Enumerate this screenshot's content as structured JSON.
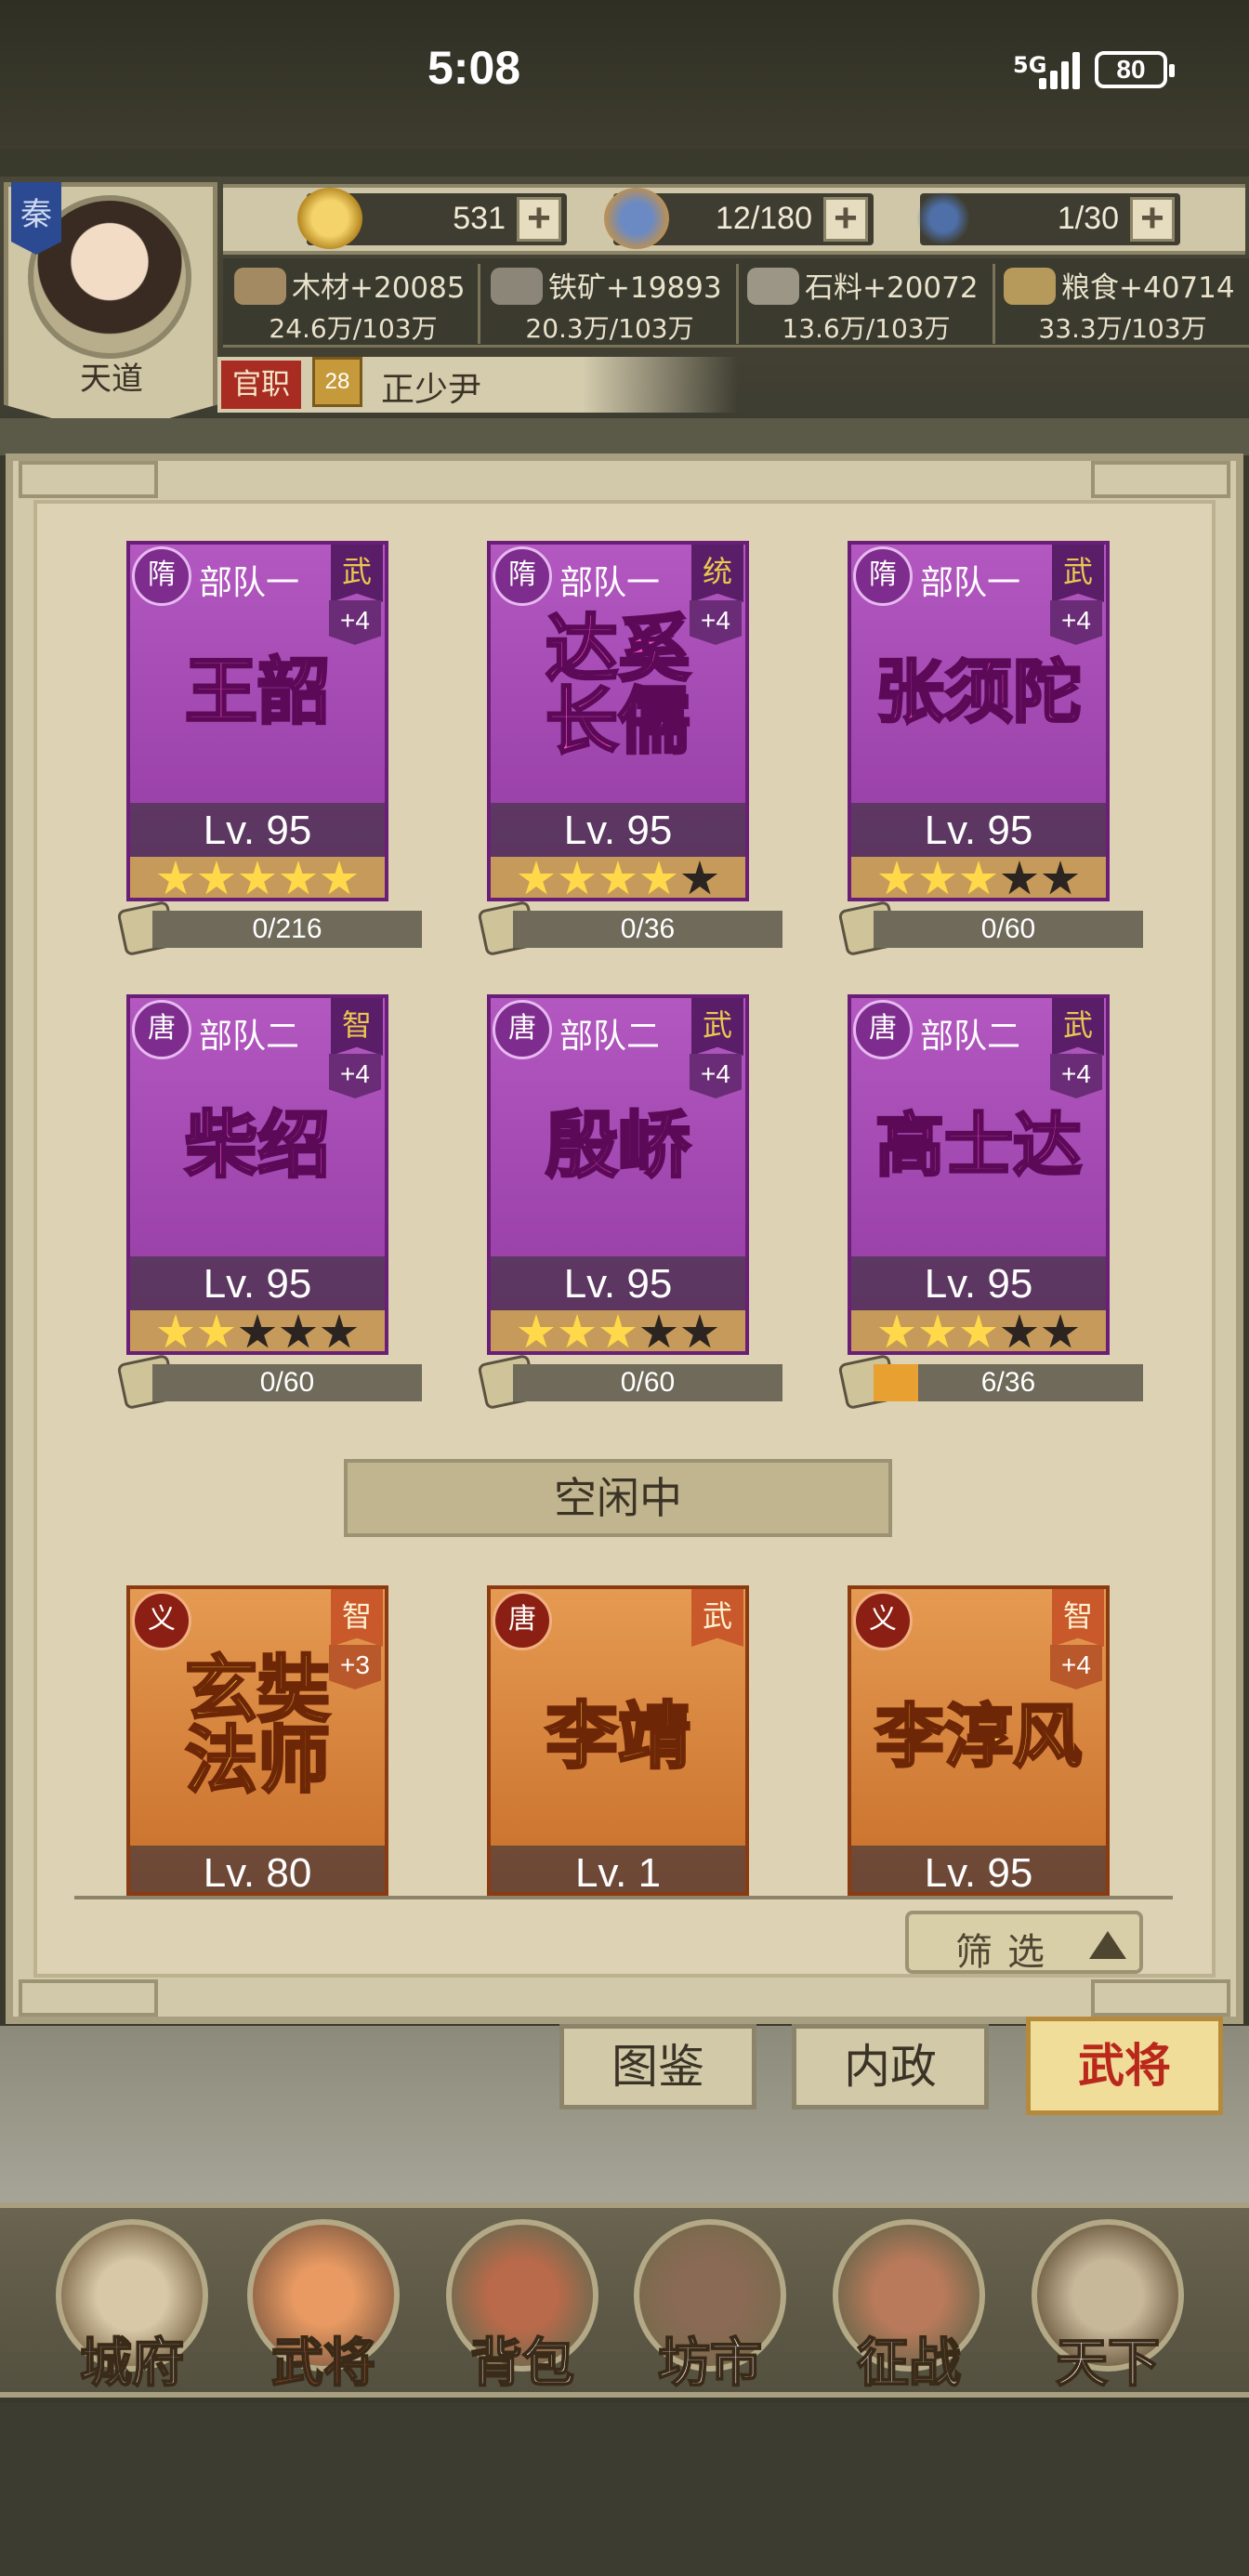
{
  "status_bar": {
    "time": "5:08",
    "signal": "5G",
    "battery": "80"
  },
  "player": {
    "faction": "秦",
    "name": "天道",
    "rank_label": "官职",
    "rank_level": "28",
    "rank_title": "正少尹"
  },
  "resources": {
    "gold": "531",
    "food_supply": "12/180",
    "tokens": "1/30",
    "wood": {
      "label": "木材+20085",
      "amount": "24.6万/103万"
    },
    "iron": {
      "label": "铁矿+19893",
      "amount": "20.3万/103万"
    },
    "stone": {
      "label": "石料+20072",
      "amount": "13.6万/103万"
    },
    "grain": {
      "label": "粮食+40714",
      "amount": "33.3万/103万"
    }
  },
  "generals": [
    {
      "dynasty": "隋",
      "team": "部队一",
      "type": "武",
      "bonus": "+4",
      "name": "王韶",
      "level": "Lv. 95",
      "stars": 5,
      "fragments": "0/216",
      "progress": 0
    },
    {
      "dynasty": "隋",
      "team": "部队一",
      "type": "统",
      "bonus": "+4",
      "name": "达奚长儒",
      "name_l1": "达奚",
      "name_l2": "长儒",
      "level": "Lv. 95",
      "stars": 4,
      "fragments": "0/36",
      "progress": 0
    },
    {
      "dynasty": "隋",
      "team": "部队一",
      "type": "武",
      "bonus": "+4",
      "name": "张须陀",
      "level": "Lv. 95",
      "stars": 3,
      "fragments": "0/60",
      "progress": 0
    },
    {
      "dynasty": "唐",
      "team": "部队二",
      "type": "智",
      "bonus": "+4",
      "name": "柴绍",
      "level": "Lv. 95",
      "stars": 2,
      "fragments": "0/60",
      "progress": 0
    },
    {
      "dynasty": "唐",
      "team": "部队二",
      "type": "武",
      "bonus": "+4",
      "name": "殷峤",
      "level": "Lv. 95",
      "stars": 3,
      "fragments": "0/60",
      "progress": 0
    },
    {
      "dynasty": "唐",
      "team": "部队二",
      "type": "武",
      "bonus": "+4",
      "name": "高士达",
      "level": "Lv. 95",
      "stars": 3,
      "fragments": "6/36",
      "progress": 0.1667
    }
  ],
  "idle_label": "空闲中",
  "idle_generals": [
    {
      "dynasty": "义",
      "type": "智",
      "bonus": "+3",
      "name_l1": "玄奘",
      "name_l2": "法师",
      "level": "Lv. 80"
    },
    {
      "dynasty": "唐",
      "type": "武",
      "bonus": "",
      "name_l1": "李靖",
      "name_l2": "",
      "level": "Lv. 1"
    },
    {
      "dynasty": "义",
      "type": "智",
      "bonus": "+4",
      "name_l1": "李淳风",
      "name_l2": "",
      "level": "Lv. 95"
    }
  ],
  "filter_label": "筛选",
  "sub_tabs": [
    "图鉴",
    "内政",
    "武将"
  ],
  "nav": [
    "城府",
    "武将",
    "背包",
    "坊市",
    "征战",
    "天下"
  ],
  "colors": {
    "purple_card": "#a84bb7",
    "gold_card": "#d8843e",
    "active_red": "#b9281a"
  }
}
